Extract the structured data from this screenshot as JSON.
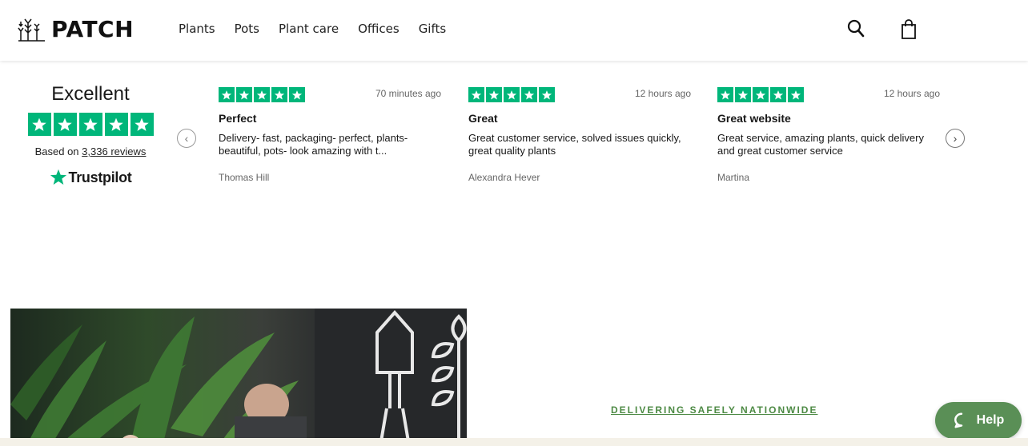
{
  "header": {
    "logo_text": "PATCH",
    "nav": [
      "Plants",
      "Pots",
      "Plant care",
      "Offices",
      "Gifts"
    ],
    "icons": [
      "search-icon",
      "bag-icon"
    ]
  },
  "trustpilot": {
    "rating_label": "Excellent",
    "based_on": "Based on",
    "reviews_link": "3,336 reviews",
    "brand": "Trustpilot",
    "star_color": "#00b67a",
    "stars": 5
  },
  "reviews": [
    {
      "time": "70 minutes ago",
      "title": "Perfect",
      "body": "Delivery- fast, packaging- perfect, plants- beautiful, pots- look amazing with t...",
      "author": "Thomas Hill",
      "stars": 5
    },
    {
      "time": "12 hours ago",
      "title": "Great",
      "body": "Great customer service, solved issues quickly, great quality plants",
      "author": "Alexandra Hever",
      "stars": 5
    },
    {
      "time": "12 hours ago",
      "title": "Great website",
      "body": "Great service, amazing plants, quick delivery and great customer service",
      "author": "Martina",
      "stars": 5
    }
  ],
  "carousel": {
    "prev_icon": "chevron-left-icon",
    "next_icon": "chevron-right-icon"
  },
  "promo": {
    "link_text": "DELIVERING SAFELY NATIONWIDE",
    "accent": "#4d8a44"
  },
  "help": {
    "label": "Help",
    "color": "#5a8f56"
  }
}
